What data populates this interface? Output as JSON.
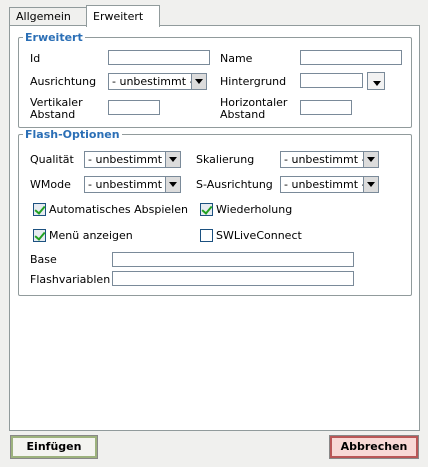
{
  "tabs": [
    {
      "label": "Allgemein"
    },
    {
      "label": "Erweitert"
    }
  ],
  "advanced": {
    "legend": "Erweitert",
    "id_label": "Id",
    "id_value": "",
    "name_label": "Name",
    "name_value": "",
    "align_label": "Ausrichtung",
    "align_value": "- unbestimmt -",
    "background_label": "Hintergrund",
    "background_value": "",
    "vspace_label": "Vertikaler Abstand",
    "vspace_value": "",
    "hspace_label": "Horizontaler Abstand",
    "hspace_value": ""
  },
  "flash": {
    "legend": "Flash-Optionen",
    "quality_label": "Qualität",
    "quality_value": "- unbestimmt -",
    "scale_label": "Skalierung",
    "scale_value": "- unbestimmt -",
    "wmode_label": "WMode",
    "wmode_value": "- unbestimmt -",
    "salign_label": "S-Ausrichtung",
    "salign_value": "- unbestimmt -",
    "autoplay_label": "Automatisches Abspielen",
    "autoplay_checked": true,
    "loop_label": "Wiederholung",
    "loop_checked": true,
    "menu_label": "Menü anzeigen",
    "menu_checked": true,
    "swlive_label": "SWLiveConnect",
    "swlive_checked": false,
    "base_label": "Base",
    "base_value": "",
    "flashvars_label": "Flashvariablen",
    "flashvars_value": ""
  },
  "buttons": {
    "insert_label": "Einfügen",
    "cancel_label": "Abbrechen"
  },
  "colors": {
    "legend": "#2b6fb6",
    "insert_border": "#9db27d",
    "cancel_border": "#b95757",
    "checkmark": "#21a121"
  }
}
